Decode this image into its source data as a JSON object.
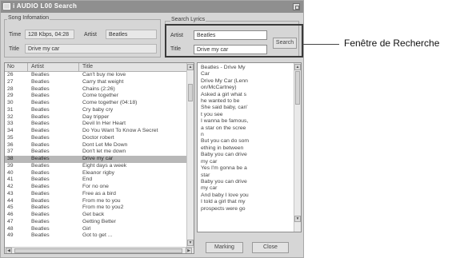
{
  "window": {
    "title": "i AUDIO L00  Search"
  },
  "song_info": {
    "group_label": "Song Infomation",
    "time_label": "Time",
    "time_value": "128 Kbps, 04:28",
    "artist_label": "Artist",
    "artist_value": "Beatles",
    "title_label": "Title",
    "title_value": "Drive my car"
  },
  "search_lyrics": {
    "group_label": "Search Lyrics",
    "artist_label": "Artist",
    "artist_value": "Beatles",
    "title_label": "Title",
    "title_value": "Drive my car",
    "search_button": "Search"
  },
  "song_list": {
    "columns": [
      "No",
      "Artist",
      "Title"
    ],
    "selected_index": 12,
    "rows": [
      {
        "no": "26",
        "artist": "Beatles",
        "title": "Can't buy me love"
      },
      {
        "no": "27",
        "artist": "Beatles",
        "title": "Carry that weight"
      },
      {
        "no": "28",
        "artist": "Beatles",
        "title": "Chains (2:26)"
      },
      {
        "no": "29",
        "artist": "Beatles",
        "title": "Come together"
      },
      {
        "no": "30",
        "artist": "Beatles",
        "title": "Come together (04:18)"
      },
      {
        "no": "31",
        "artist": "Beatles",
        "title": "Cry baby cry"
      },
      {
        "no": "32",
        "artist": "Beatles",
        "title": "Day tripper"
      },
      {
        "no": "33",
        "artist": "Beatles",
        "title": "Devil In Her Heart"
      },
      {
        "no": "34",
        "artist": "Beatles",
        "title": "Do You Want To Know A Secret"
      },
      {
        "no": "35",
        "artist": "Beatles",
        "title": "Doctor robert"
      },
      {
        "no": "36",
        "artist": "Beatles",
        "title": "Dont Let Me Down"
      },
      {
        "no": "37",
        "artist": "Beatles",
        "title": "Don't let me down"
      },
      {
        "no": "38",
        "artist": "Beatles",
        "title": "Drive my car"
      },
      {
        "no": "39",
        "artist": "Beatles",
        "title": "Eight days a week"
      },
      {
        "no": "40",
        "artist": "Beatles",
        "title": "Eleanor rigby"
      },
      {
        "no": "41",
        "artist": "Beatles",
        "title": "End"
      },
      {
        "no": "42",
        "artist": "Beatles",
        "title": "For no one"
      },
      {
        "no": "43",
        "artist": "Beatles",
        "title": "Free as a bird"
      },
      {
        "no": "44",
        "artist": "Beatles",
        "title": "From me to you"
      },
      {
        "no": "45",
        "artist": "Beatles",
        "title": "From me to you2"
      },
      {
        "no": "46",
        "artist": "Beatles",
        "title": "Get back"
      },
      {
        "no": "47",
        "artist": "Beatles",
        "title": "Getting Better"
      },
      {
        "no": "48",
        "artist": "Beatles",
        "title": "Girl"
      },
      {
        "no": "49",
        "artist": "Beatles",
        "title": "Got to get ..."
      }
    ]
  },
  "lyrics": {
    "text": "Beatles - Drive My\nCar\nDrive My Car (Lenn\non/McCartney)\nAsked a girl what s\nhe wanted to be\nShe said baby, can'\nt you see\nI wanna be famous,\na star on the scree\nn\nBut you can do som\nething in between\nBaby you can drive\nmy car\nYes I'm gonna be a\nstar\nBaby you can drive\nmy car\nAnd baby I love you\nI told a girl that my\nprospects were go"
  },
  "buttons": {
    "marking": "Marking",
    "close": "Close"
  },
  "callout": {
    "text": "Fenêtre de Recherche"
  }
}
